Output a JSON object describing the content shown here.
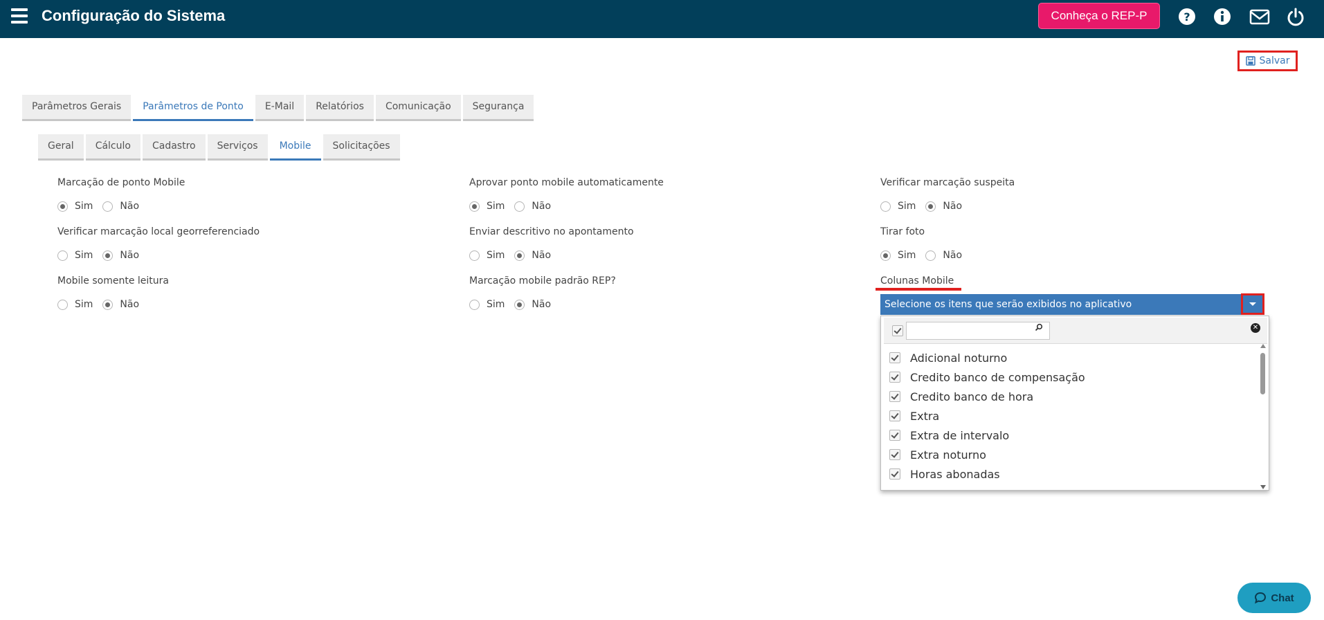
{
  "header": {
    "title": "Configuração do Sistema",
    "rep_button": "Conheça o REP-P",
    "icons": [
      "help-icon",
      "info-icon",
      "mail-icon",
      "power-icon"
    ]
  },
  "toolbar": {
    "save_label": "Salvar"
  },
  "main_tabs": [
    {
      "label": "Parâmetros Gerais",
      "active": false
    },
    {
      "label": "Parâmetros de Ponto",
      "active": true
    },
    {
      "label": "E-Mail",
      "active": false
    },
    {
      "label": "Relatórios",
      "active": false
    },
    {
      "label": "Comunicação",
      "active": false
    },
    {
      "label": "Segurança",
      "active": false
    }
  ],
  "sub_tabs": [
    {
      "label": "Geral",
      "active": false
    },
    {
      "label": "Cálculo",
      "active": false
    },
    {
      "label": "Cadastro",
      "active": false
    },
    {
      "label": "Serviços",
      "active": false
    },
    {
      "label": "Mobile",
      "active": true
    },
    {
      "label": "Solicitações",
      "active": false
    }
  ],
  "options": {
    "yes": "Sim",
    "no": "Não"
  },
  "fields": [
    {
      "label": "Marcação de ponto Mobile",
      "value": "Sim"
    },
    {
      "label": "Aprovar ponto mobile automaticamente",
      "value": "Sim"
    },
    {
      "label": "Verificar marcação suspeita",
      "value": "Não"
    },
    {
      "label": "Verificar marcação local georreferenciado",
      "value": "Não"
    },
    {
      "label": "Enviar descritivo no apontamento",
      "value": "Não"
    },
    {
      "label": "Tirar foto",
      "value": "Sim"
    },
    {
      "label": "Mobile somente leitura",
      "value": "Não"
    },
    {
      "label": "Marcação mobile padrão REP?",
      "value": "Não"
    }
  ],
  "colunas": {
    "label": "Colunas Mobile",
    "placeholder": "Selecione os itens que serão exibidos no aplicativo",
    "items": [
      {
        "label": "Adicional noturno",
        "checked": true
      },
      {
        "label": "Credito banco de compensação",
        "checked": true
      },
      {
        "label": "Credito banco de hora",
        "checked": true
      },
      {
        "label": "Extra",
        "checked": true
      },
      {
        "label": "Extra de intervalo",
        "checked": true
      },
      {
        "label": "Extra noturno",
        "checked": true
      },
      {
        "label": "Horas abonadas",
        "checked": true
      }
    ]
  },
  "chat": {
    "label": "Chat"
  },
  "colors": {
    "header_bg": "#023f5a",
    "accent": "#3b79b9",
    "rep_button": "#e8196a",
    "highlight": "#e0211f",
    "chat": "#1f9ec1"
  }
}
